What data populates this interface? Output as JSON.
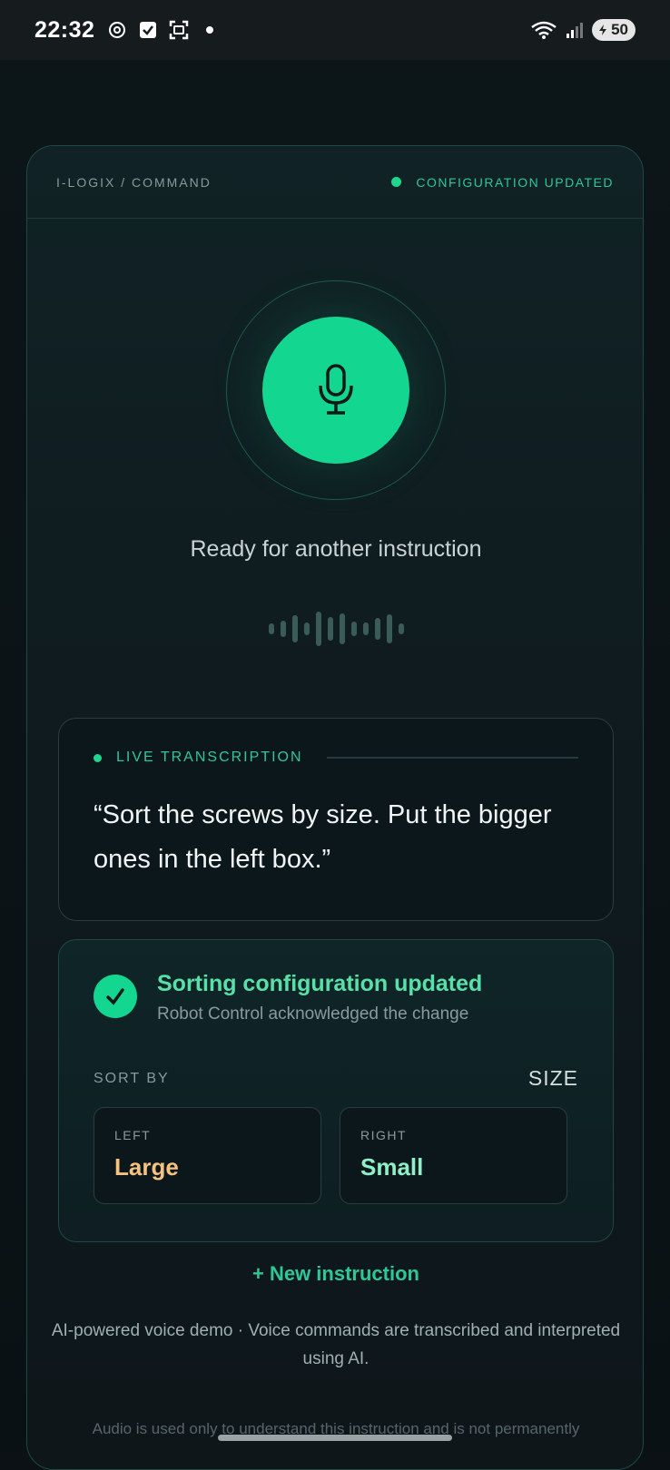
{
  "status_bar": {
    "time": "22:32",
    "battery": "50",
    "icons": [
      "chatgpt-icon",
      "checkbox-icon",
      "screenshot-icon",
      "notification-dot",
      "wifi-icon",
      "signal-icon",
      "battery-icon"
    ]
  },
  "header": {
    "breadcrumb": "I-LOGIX / COMMAND",
    "status": "CONFIGURATION UPDATED"
  },
  "mic": {
    "ready_text": "Ready for another instruction"
  },
  "transcription": {
    "label": "LIVE TRANSCRIPTION",
    "text": "“Sort the screws by size. Put the bigger ones in the left box.”"
  },
  "result": {
    "title": "Sorting configuration updated",
    "subtitle": "Robot Control acknowledged the change",
    "sort_by_label": "SORT BY",
    "sort_by_value": "SIZE",
    "left": {
      "label": "LEFT",
      "value": "Large"
    },
    "right": {
      "label": "RIGHT",
      "value": "Small"
    }
  },
  "actions": {
    "new_instruction": "+ New instruction"
  },
  "footer": {
    "note": "AI-powered voice demo · Voice commands are transcribed and interpreted using AI.",
    "privacy": "Audio is used only to understand this instruction and is not permanently"
  },
  "colors": {
    "accent": "#13d690",
    "left_value": "#f5c27f",
    "right_value": "#8ef0c7"
  }
}
